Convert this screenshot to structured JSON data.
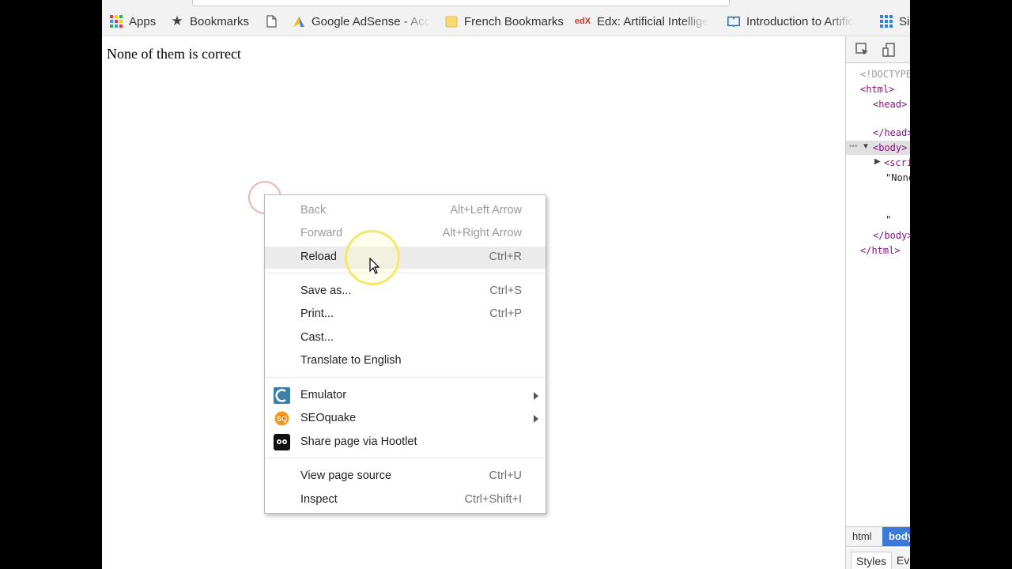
{
  "bookmarks": [
    {
      "label": "Apps",
      "icon": "apps-grid-icon"
    },
    {
      "label": "Bookmarks",
      "icon": "star-icon"
    },
    {
      "label": "",
      "icon": "page-icon"
    },
    {
      "label": "Google AdSense - Acc",
      "icon": "adsense-icon"
    },
    {
      "label": "French Bookmarks",
      "icon": "folder-icon"
    },
    {
      "label": "Edx: Artificial Intellige",
      "icon": "edx-icon"
    },
    {
      "label": "Introduction to Artific",
      "icon": "book-icon"
    },
    {
      "label": "Si",
      "icon": "grid-icon"
    }
  ],
  "page": {
    "text": "None of them is correct"
  },
  "context_menu": {
    "items": [
      {
        "label": "Back",
        "shortcut": "Alt+Left Arrow",
        "disabled": true
      },
      {
        "label": "Forward",
        "shortcut": "Alt+Right Arrow",
        "disabled": true
      },
      {
        "label": "Reload",
        "shortcut": "Ctrl+R",
        "highlighted": true
      },
      {
        "label": "Save as...",
        "shortcut": "Ctrl+S"
      },
      {
        "label": "Print...",
        "shortcut": "Ctrl+P"
      },
      {
        "label": "Cast...",
        "shortcut": ""
      },
      {
        "label": "Translate to English",
        "shortcut": ""
      },
      {
        "label": "Emulator",
        "icon": "emulator-icon",
        "submenu": true
      },
      {
        "label": "SEOquake",
        "icon": "seoquake-icon",
        "submenu": true
      },
      {
        "label": "Share page via Hootlet",
        "icon": "hootlet-owl-icon"
      },
      {
        "label": "View page source",
        "shortcut": "Ctrl+U"
      },
      {
        "label": "Inspect",
        "shortcut": "Ctrl+Shift+I"
      }
    ]
  },
  "devtools": {
    "lines": [
      "<!DOCTYPE",
      "<html>",
      "<head>",
      "</head>",
      "<body>",
      "<scri",
      "\"None",
      "\"",
      "</body>",
      "</html>"
    ],
    "crumbs": [
      "html",
      "body"
    ],
    "tabs": [
      "Styles",
      "Ev"
    ]
  },
  "colors": {
    "selected_crumb": "#3879d9",
    "tag": "#881280",
    "halo": "#f4e86a"
  }
}
